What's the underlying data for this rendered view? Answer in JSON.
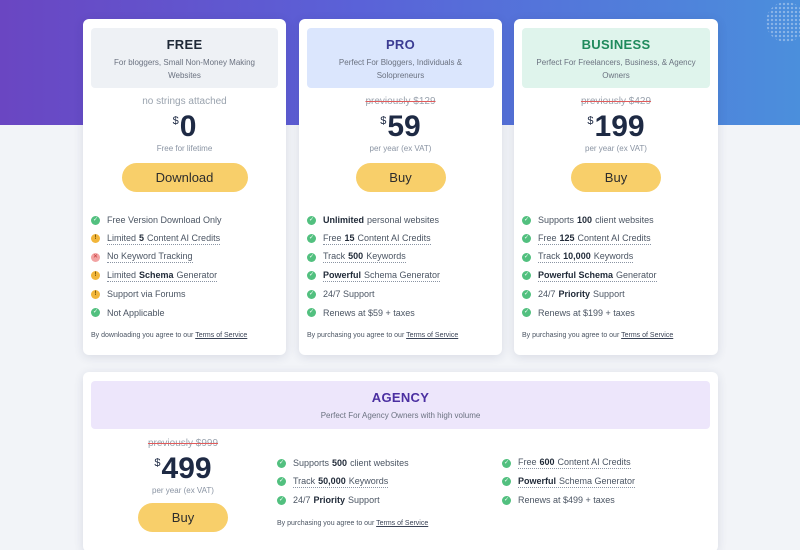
{
  "plans": {
    "free": {
      "name": "FREE",
      "subtitle": "For bloggers, Small Non-Money Making Websites",
      "previous": "no strings attached",
      "currency": "$",
      "price": "0",
      "period": "Free for lifetime",
      "button": "Download",
      "features": [
        {
          "pre": "Free Version Download Only",
          "bold": "",
          "post": ""
        },
        {
          "pre": "Limited",
          "bold": "5",
          "post": "Content AI Credits"
        },
        {
          "pre": "No Keyword Tracking",
          "bold": "",
          "post": ""
        },
        {
          "pre": "Limited",
          "bold": "Schema",
          "post": "Generator"
        },
        {
          "pre": "Support via Forums",
          "bold": "",
          "post": ""
        },
        {
          "pre": "Not Applicable",
          "bold": "",
          "post": ""
        }
      ],
      "terms_prefix": "By downloading you agree to our",
      "terms_link": "Terms of Service"
    },
    "pro": {
      "name": "PRO",
      "subtitle": "Perfect For Bloggers, Individuals & Solopreneurs",
      "previous": "previously $129",
      "currency": "$",
      "price": "59",
      "period": "per year (ex VAT)",
      "button": "Buy",
      "features": [
        {
          "pre": "",
          "bold": "Unlimited",
          "post": "personal websites"
        },
        {
          "pre": "Free",
          "bold": "15",
          "post": "Content AI Credits"
        },
        {
          "pre": "Track",
          "bold": "500",
          "post": "Keywords"
        },
        {
          "pre": "",
          "bold": "Powerful",
          "post": "Schema Generator"
        },
        {
          "pre": "24/7 Support",
          "bold": "",
          "post": ""
        },
        {
          "pre": "Renews at $59 + taxes",
          "bold": "",
          "post": ""
        }
      ],
      "terms_prefix": "By purchasing you agree to our",
      "terms_link": "Terms of Service"
    },
    "business": {
      "name": "BUSINESS",
      "subtitle": "Perfect For Freelancers, Business, & Agency Owners",
      "previous": "previously $429",
      "currency": "$",
      "price": "199",
      "period": "per year (ex VAT)",
      "button": "Buy",
      "features": [
        {
          "pre": "Supports",
          "bold": "100",
          "post": "client websites"
        },
        {
          "pre": "Free",
          "bold": "125",
          "post": "Content AI Credits"
        },
        {
          "pre": "Track",
          "bold": "10,000",
          "post": "Keywords"
        },
        {
          "pre": "",
          "bold": "Powerful Schema",
          "post": "Generator"
        },
        {
          "pre": "24/7",
          "bold": "Priority",
          "post": "Support"
        },
        {
          "pre": "Renews at $199 + taxes",
          "bold": "",
          "post": ""
        }
      ],
      "terms_prefix": "By purchasing you agree to our",
      "terms_link": "Terms of Service"
    },
    "agency": {
      "name": "AGENCY",
      "subtitle": "Perfect For Agency Owners with high volume",
      "previous": "previously $999",
      "currency": "$",
      "price": "499",
      "period": "per year (ex VAT)",
      "button": "Buy",
      "features_left": [
        {
          "pre": "Supports",
          "bold": "500",
          "post": "client websites"
        },
        {
          "pre": "Track",
          "bold": "50,000",
          "post": "Keywords"
        },
        {
          "pre": "24/7",
          "bold": "Priority",
          "post": "Support"
        }
      ],
      "features_right": [
        {
          "pre": "Free",
          "bold": "600",
          "post": "Content AI Credits"
        },
        {
          "pre": "",
          "bold": "Powerful",
          "post": "Schema Generator"
        },
        {
          "pre": "Renews at $499 + taxes",
          "bold": "",
          "post": ""
        }
      ],
      "terms_prefix": "By purchasing you agree to our",
      "terms_link": "Terms of Service"
    }
  },
  "colors": {
    "header_gradient_start": "#6a46c2",
    "header_gradient_end": "#4b8fdc",
    "button": "#f8cf6a",
    "check": "#52c07f",
    "warning": "#f2b63a",
    "cross": "#f2a3a3"
  }
}
